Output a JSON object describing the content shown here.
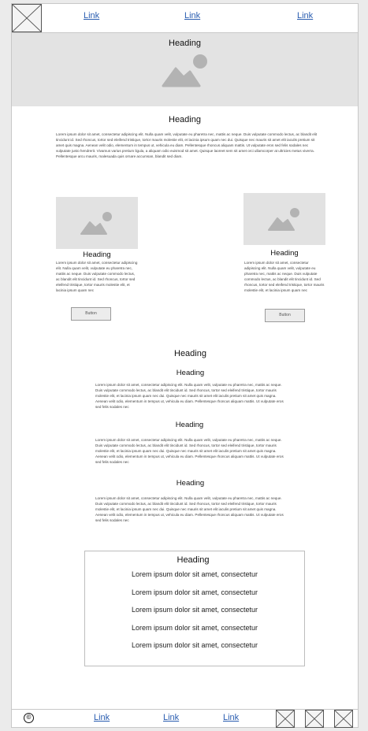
{
  "header": {
    "logo_icon": "placeholder-x-icon",
    "links": [
      "Link",
      "Link",
      "Link"
    ]
  },
  "hero": {
    "heading": "Heading",
    "image_icon": "image-placeholder-icon"
  },
  "intro": {
    "heading": "Heading",
    "body": "Lorem ipsum dolor sit amet, consectetur adipiscing elit. Nulla quam velit, vulputate eu pharetra nec, mattis ac neque. Duis vulputate commodo lectus, ac blandit elit tincidunt id. Sed rhoncus, tortor sed eleifend tristique, tortor mauris molestie elit, et lacinia ipsum quam nec dui. Quisque nec mauris sit amet elit iaculis pretium sit amet quis magna. Aenean velit odio, elementum in tempus ut, vehicula eu diam. Pellentesque rhoncus aliquam mattis. Ut vulputate eros sed felis sodales nec vulputate justo hendrerit. Vivamus varius pretium ligula, a aliquam odio euismod sit amet. Quisque laoreet sem sit amet orci ullamcorper at ultricies metus viverra. Pellentesque arcu mauris, malesuada quis ornare accumsan, blandit sed diam."
  },
  "columns": [
    {
      "heading": "Heading",
      "body": "Lorem ipsum dolor sit amet, consectetur adipiscing elit. Nulla quam velit, vulputate eu pharetra nec, mattis ac neque. Duis vulputate commodo lectus, ac blandit elit tincidunt id. Sed rhoncus, tortor sed eleifend tristique, tortor mauris molestie elit, et lacinia ipsum quam nec",
      "button": "Button"
    },
    {
      "heading": "Heading",
      "body": "Lorem ipsum dolor sit amet, consectetur adipiscing elit. Nulla quam velit, vulputate eu pharetra nec, mattis ac neque. Duis vulputate commodo lectus, ac blandit elit tincidunt id. Sed rhoncus, tortor sed eleifend tristique, tortor mauris molestie elit, et lacinia ipsum quam nec",
      "button": "Button"
    }
  ],
  "articles": {
    "heading": "Heading",
    "items": [
      {
        "heading": "Heading",
        "body": "Lorem ipsum dolor sit amet, consectetur adipiscing elit. Nulla quam velit, vulputate eu pharetra nec, mattis ac neque. Duis vulputate commodo lectus, ac blandit elit tincidunt id. Sed rhoncus, tortor sed eleifend tristique, tortor mauris molestie elit, et lacinia ipsum quam nec dui. Quisque nec mauris sit amet elit iaculis pretium sit amet quis magna. Aenean velit odio, elementum in tempus ut, vehicula eu diam. Pellentesque rhoncus aliquam mattis. Ut vulputate eros sed felis sodales nec"
      },
      {
        "heading": "Heading",
        "body": "Lorem ipsum dolor sit amet, consectetur adipiscing elit. Nulla quam velit, vulputate eu pharetra nec, mattis ac neque. Duis vulputate commodo lectus, ac blandit elit tincidunt id. Sed rhoncus, tortor sed eleifend tristique, tortor mauris molestie elit, et lacinia ipsum quam nec dui. Quisque nec mauris sit amet elit iaculis pretium sit amet quis magna. Aenean velit odio, elementum in tempus ut, vehicula eu diam. Pellentesque rhoncus aliquam mattis. Ut vulputate eros sed felis sodales nec"
      },
      {
        "heading": "Heading",
        "body": "Lorem ipsum dolor sit amet, consectetur adipiscing elit. Nulla quam velit, vulputate eu pharetra nec, mattis ac neque. Duis vulputate commodo lectus, ac blandit elit tincidunt id. Sed rhoncus, tortor sed eleifend tristique, tortor mauris molestie elit, et lacinia ipsum quam nec dui. Quisque nec mauris sit amet elit iaculis pretium sit amet quis magna. Aenean velit odio, elementum in tempus ut, vehicula eu diam. Pellentesque rhoncus aliquam mattis. Ut vulputate eros sed felis sodales nec"
      }
    ]
  },
  "card": {
    "heading": "Heading",
    "lines": [
      "Lorem ipsum dolor sit amet, consectetur",
      "Lorem ipsum dolor sit amet, consectetur",
      "Lorem ipsum dolor sit amet, consectetur",
      "Lorem ipsum dolor sit amet, consectetur",
      "Lorem ipsum dolor sit amet, consectetur"
    ]
  },
  "footer": {
    "copyright_symbol": "©",
    "links": [
      "Link",
      "Link",
      "Link"
    ],
    "social_icons": [
      "placeholder-x-icon",
      "placeholder-x-icon",
      "placeholder-x-icon"
    ]
  }
}
